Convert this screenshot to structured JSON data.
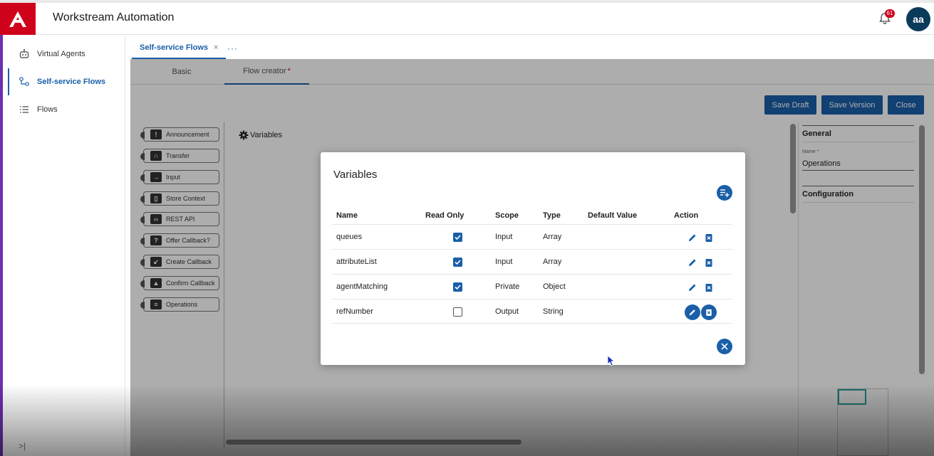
{
  "header": {
    "app_title": "Workstream Automation",
    "notification_count": "61",
    "avatar_initials": "aa"
  },
  "sidebar": {
    "items": [
      {
        "label": "Virtual Agents"
      },
      {
        "label": "Self-service Flows"
      },
      {
        "label": "Flows"
      }
    ],
    "collapse_glyph": ">|"
  },
  "tabs": {
    "active_label": "Self-service Flows",
    "close_glyph": "×",
    "more_glyph": "···"
  },
  "subtabs": {
    "basic": "Basic",
    "flow_creator": "Flow creator",
    "required_mark": "*"
  },
  "toolbar": {
    "save_draft": "Save Draft",
    "save_version": "Save Version",
    "close": "Close"
  },
  "palette": [
    "Announcement",
    "Transfer",
    "Input",
    "Store Context",
    "REST API",
    "Offer Callback?",
    "Create Callback",
    "Confirm Callback",
    "Operations"
  ],
  "canvas": {
    "label": "Variables"
  },
  "properties": {
    "general_heading": "General",
    "name_label": "Name *",
    "name_value": "Operations",
    "configuration_heading": "Configuration"
  },
  "modal": {
    "title": "Variables",
    "columns": {
      "name": "Name",
      "read_only": "Read Only",
      "scope": "Scope",
      "type": "Type",
      "default_value": "Default Value",
      "action": "Action"
    },
    "rows": [
      {
        "name": "queues",
        "read_only": true,
        "scope": "Input",
        "type": "Array",
        "default_value": ""
      },
      {
        "name": "attributeList",
        "read_only": true,
        "scope": "Input",
        "type": "Array",
        "default_value": ""
      },
      {
        "name": "agentMatching",
        "read_only": true,
        "scope": "Private",
        "type": "Object",
        "default_value": ""
      },
      {
        "name": "refNumber",
        "read_only": false,
        "scope": "Output",
        "type": "String",
        "default_value": ""
      }
    ]
  },
  "colors": {
    "brand_red": "#d0021b",
    "accent_blue": "#1a5fa8",
    "avatar_bg": "#0a3a5a"
  }
}
